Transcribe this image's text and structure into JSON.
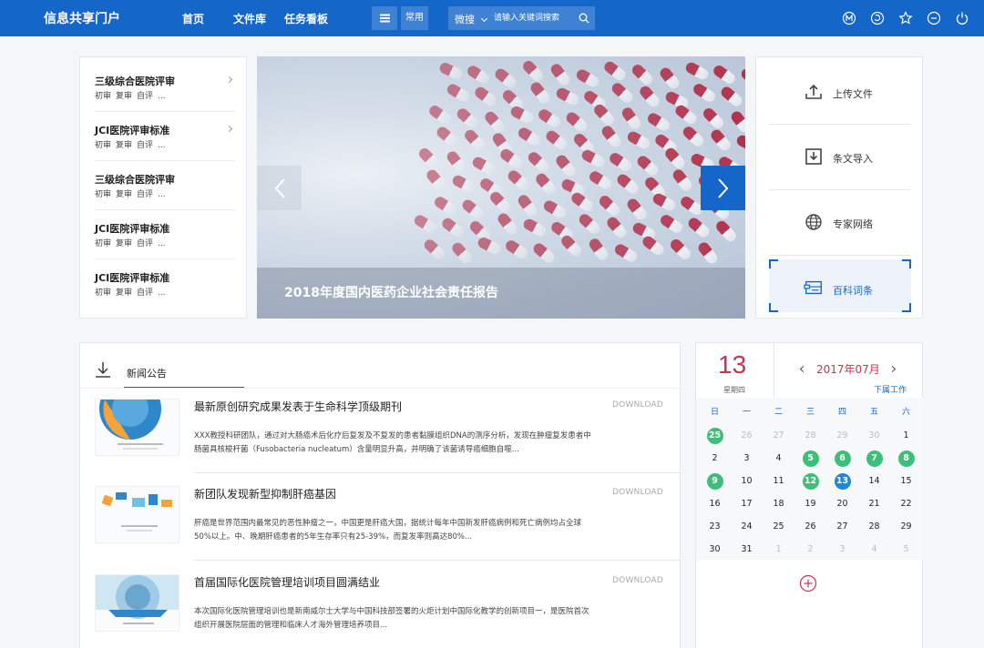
{
  "header": {
    "brand": "信息共享门户",
    "nav": [
      "首页",
      "文件库",
      "任务看板"
    ],
    "common_label": "常用",
    "search_category": "微搜",
    "search_placeholder": "请输入关键词搜索",
    "icons": [
      "m-circle-icon",
      "refresh-icon",
      "star-icon",
      "minus-circle-icon",
      "power-icon"
    ]
  },
  "categories": [
    {
      "title": "三级综合医院评审",
      "tags": [
        "初审",
        "复审",
        "自评",
        "..."
      ],
      "arrow": true
    },
    {
      "title": "JCI医院评审标准",
      "tags": [
        "初审",
        "复审",
        "自评",
        "..."
      ],
      "arrow": true
    },
    {
      "title": "三级综合医院评审",
      "tags": [
        "初审",
        "复审",
        "自评",
        "..."
      ],
      "arrow": false
    },
    {
      "title": "JCI医院评审标准",
      "tags": [
        "初审",
        "复审",
        "自评",
        "..."
      ],
      "arrow": false
    },
    {
      "title": "JCI医院评审标准",
      "tags": [
        "初审",
        "复审",
        "自评",
        "..."
      ],
      "arrow": false
    }
  ],
  "banner": {
    "caption": "2018年度国内医药企业社会责任报告"
  },
  "actions": [
    {
      "label": "上传文件",
      "icon": "upload-icon"
    },
    {
      "label": "条文导入",
      "icon": "import-icon"
    },
    {
      "label": "专家网络",
      "icon": "globe-icon"
    },
    {
      "label": "百科词条",
      "icon": "encyclopedia-icon",
      "selected": true
    }
  ],
  "news": {
    "section_title": "新闻公告",
    "download_label": "DOWNLOAD",
    "items": [
      {
        "title": "最新原创研究成果发表于生命科学顶级期刊",
        "text": "XXX教授科研团队，通过对大肠癌术后化疗后复发及不复发的患者黏膜组织DNA的测序分析，发现在肿瘤复发患者中肠菌具核梭杆菌（Fusobacteria nucleatum）含量明显升高，并明确了该菌诱导癌细胞自噬..."
      },
      {
        "title": "新团队发现新型抑制肝癌基因",
        "text": "肝癌是世界范围内最常见的恶性肿瘤之一，中国更是肝癌大国，据统计每年中国新发肝癌病例和死亡病例均占全球50%以上。中、晚期肝癌患者的5年生存率只有25-39%，而复发率则高达80%..."
      },
      {
        "title": "首届国际化医院管理培训项目圆满结业",
        "text": "本次国际化医院管理培训也是新南威尔士大学与中国科技部签署的火炬计划中国际化教学的创新项目一，是医院首次组织开展医院层面的管理和临床人才海外管理培养项目..."
      }
    ]
  },
  "calendar": {
    "day": "13",
    "weekday": "星期四",
    "month_label": "2017年07月",
    "link_label": "下属工作",
    "weekday_headers": [
      "日",
      "一",
      "二",
      "三",
      "四",
      "五",
      "六"
    ],
    "weeks": [
      [
        {
          "d": "25",
          "dot": "green"
        },
        {
          "d": "26",
          "muted": true
        },
        {
          "d": "27",
          "muted": true
        },
        {
          "d": "28",
          "muted": true
        },
        {
          "d": "29",
          "muted": true
        },
        {
          "d": "30",
          "muted": true
        },
        {
          "d": "1"
        }
      ],
      [
        {
          "d": "2"
        },
        {
          "d": "3"
        },
        {
          "d": "4"
        },
        {
          "d": "5",
          "dot": "green"
        },
        {
          "d": "6",
          "dot": "green"
        },
        {
          "d": "7",
          "dot": "green"
        },
        {
          "d": "8",
          "dot": "green"
        }
      ],
      [
        {
          "d": "9",
          "dot": "green"
        },
        {
          "d": "10"
        },
        {
          "d": "11"
        },
        {
          "d": "12",
          "dot": "green"
        },
        {
          "d": "13",
          "dot": "blue"
        },
        {
          "d": "14"
        },
        {
          "d": "15"
        }
      ],
      [
        {
          "d": "16"
        },
        {
          "d": "17"
        },
        {
          "d": "18"
        },
        {
          "d": "19"
        },
        {
          "d": "20"
        },
        {
          "d": "21"
        },
        {
          "d": "22"
        }
      ],
      [
        {
          "d": "23"
        },
        {
          "d": "24"
        },
        {
          "d": "25"
        },
        {
          "d": "26"
        },
        {
          "d": "27"
        },
        {
          "d": "28"
        },
        {
          "d": "29"
        }
      ],
      [
        {
          "d": "30"
        },
        {
          "d": "31"
        },
        {
          "d": "1",
          "muted": true
        },
        {
          "d": "2",
          "muted": true
        },
        {
          "d": "3",
          "muted": true
        },
        {
          "d": "4",
          "muted": true
        },
        {
          "d": "5",
          "muted": true
        }
      ]
    ],
    "colors": {
      "green": "#3dbf7a",
      "blue": "#1e88d8",
      "accent": "#c8334f"
    }
  },
  "theme": {
    "primary": "#1466c8"
  }
}
